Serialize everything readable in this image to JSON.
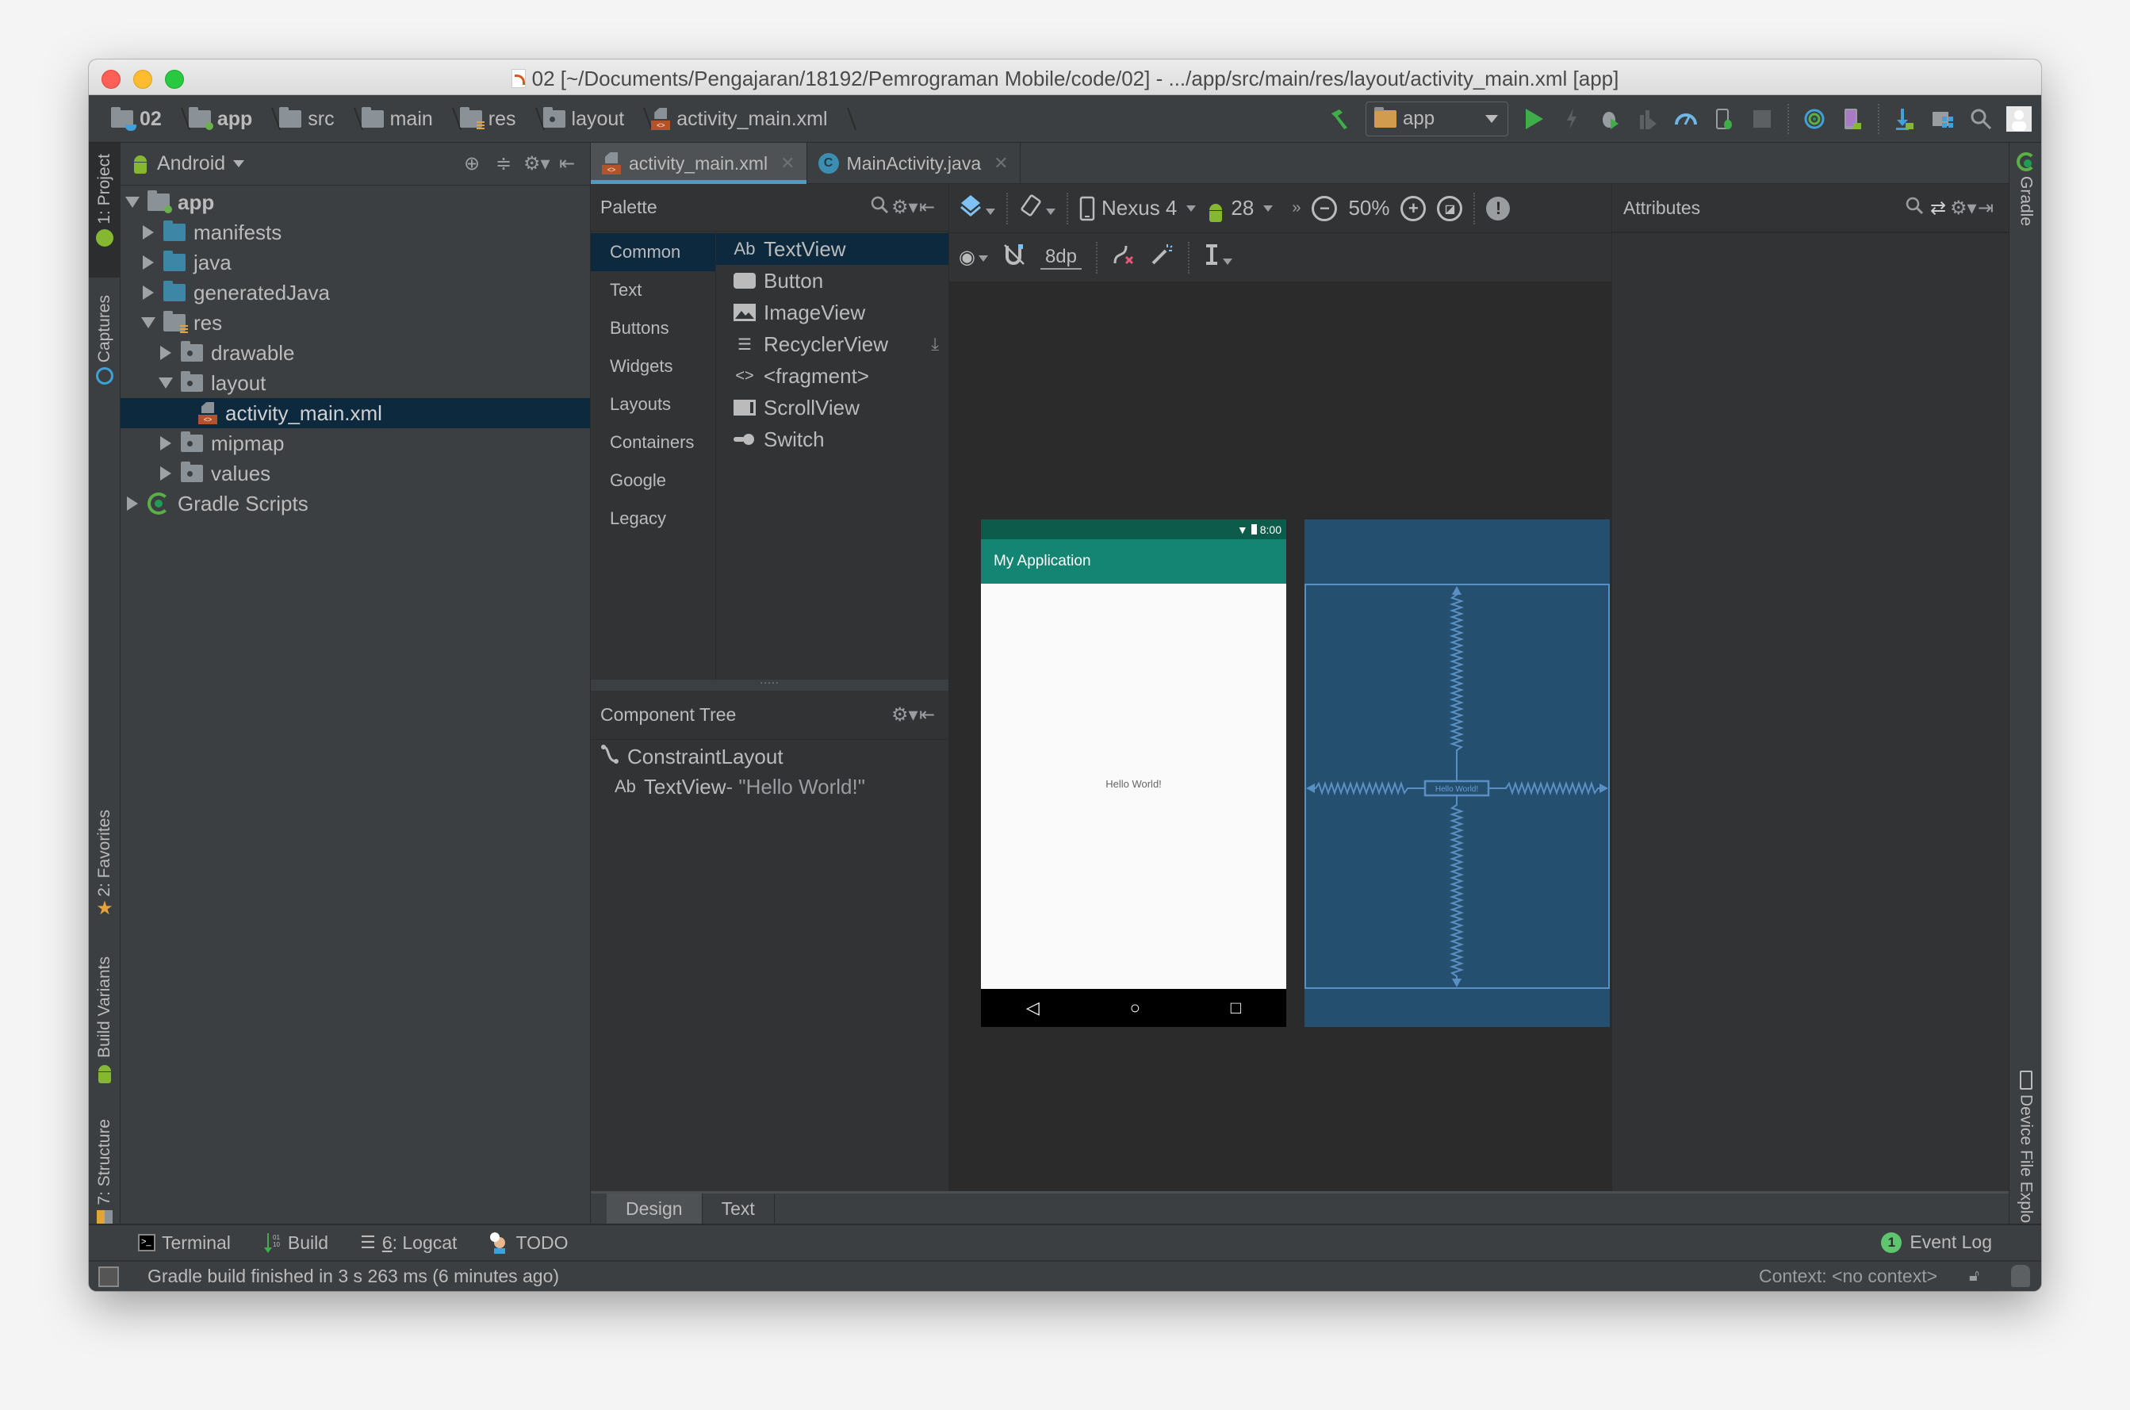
{
  "window": {
    "title": "02 [~/Documents/Pengajaran/18192/Pemrograman Mobile/code/02] - .../app/src/main/res/layout/activity_main.xml [app]"
  },
  "breadcrumbs": [
    {
      "label": "02",
      "icon": "project-folder-icon"
    },
    {
      "label": "app",
      "icon": "module-folder-icon"
    },
    {
      "label": "src",
      "icon": "folder-icon"
    },
    {
      "label": "main",
      "icon": "folder-icon"
    },
    {
      "label": "res",
      "icon": "resource-folder-icon"
    },
    {
      "label": "layout",
      "icon": "folder-icon"
    },
    {
      "label": "activity_main.xml",
      "icon": "xml-file-icon"
    }
  ],
  "toolbar": {
    "run_config": "app",
    "icons": [
      "build-hammer-icon",
      "run-icon",
      "apply-changes-icon",
      "debug-icon",
      "coverage-icon",
      "profile-icon",
      "attach-debugger-icon",
      "stop-icon",
      "sync-gradle-icon",
      "avd-manager-icon",
      "sdk-manager-icon",
      "project-structure-icon",
      "search-icon",
      "user-icon"
    ]
  },
  "left_strip": {
    "tabs": [
      {
        "label": "1: Project",
        "active": true
      },
      {
        "label": "Captures",
        "active": false
      },
      {
        "label": "2: Favorites",
        "active": false
      },
      {
        "label": "Build Variants",
        "active": false
      },
      {
        "label": "7: Structure",
        "active": false
      }
    ]
  },
  "right_strip": {
    "tabs": [
      {
        "label": "Gradle"
      },
      {
        "label": "Device File Explorer"
      }
    ]
  },
  "project_panel": {
    "view_mode": "Android",
    "tree": [
      {
        "label": "app",
        "depth": 0,
        "expanded": true,
        "bold": true
      },
      {
        "label": "manifests",
        "depth": 1,
        "expanded": false
      },
      {
        "label": "java",
        "depth": 1,
        "expanded": false
      },
      {
        "label": "generatedJava",
        "depth": 1,
        "expanded": false
      },
      {
        "label": "res",
        "depth": 1,
        "expanded": true
      },
      {
        "label": "drawable",
        "depth": 2,
        "expanded": false
      },
      {
        "label": "layout",
        "depth": 2,
        "expanded": true
      },
      {
        "label": "activity_main.xml",
        "depth": 3,
        "selected": true
      },
      {
        "label": "mipmap",
        "depth": 2,
        "expanded": false
      },
      {
        "label": "values",
        "depth": 2,
        "expanded": false
      },
      {
        "label": "Gradle Scripts",
        "depth": 0,
        "expanded": false
      }
    ]
  },
  "editor_tabs": [
    {
      "label": "activity_main.xml",
      "active": true
    },
    {
      "label": "MainActivity.java",
      "active": false
    }
  ],
  "palette": {
    "title": "Palette",
    "categories": [
      "Common",
      "Text",
      "Buttons",
      "Widgets",
      "Layouts",
      "Containers",
      "Google",
      "Legacy"
    ],
    "selected_category": "Common",
    "items": [
      {
        "label": "TextView",
        "icon": "Ab",
        "selected": true
      },
      {
        "label": "Button",
        "icon": "button-icon"
      },
      {
        "label": "ImageView",
        "icon": "image-icon"
      },
      {
        "label": "RecyclerView",
        "icon": "list-icon",
        "download": true
      },
      {
        "label": "<fragment>",
        "icon": "code-icon"
      },
      {
        "label": "ScrollView",
        "icon": "scroll-icon"
      },
      {
        "label": "Switch",
        "icon": "switch-icon"
      }
    ]
  },
  "component_tree": {
    "title": "Component Tree",
    "root": "ConstraintLayout",
    "child_prefix": "Ab",
    "child": "TextView",
    "child_text": "- \"Hello World!\""
  },
  "design_toolbar": {
    "device": "Nexus 4",
    "api_level": "28",
    "zoom": "50%",
    "default_margin": "8dp"
  },
  "preview": {
    "status_time": "8:00",
    "app_title": "My Application",
    "hello_text": "Hello World!",
    "blueprint_label": "Hello World!"
  },
  "attributes": {
    "title": "Attributes"
  },
  "view_tabs": [
    {
      "label": "Design",
      "active": true
    },
    {
      "label": "Text",
      "active": false
    }
  ],
  "tool_windows": {
    "terminal": "Terminal",
    "build": "Build",
    "logcat_num": "6",
    "logcat": ": Logcat",
    "todo": "TODO",
    "event_log": "Event Log",
    "event_count": "1"
  },
  "status": {
    "message": "Gradle build finished in 3 s 263 ms (6 minutes ago)",
    "context": "Context: <no context>"
  }
}
